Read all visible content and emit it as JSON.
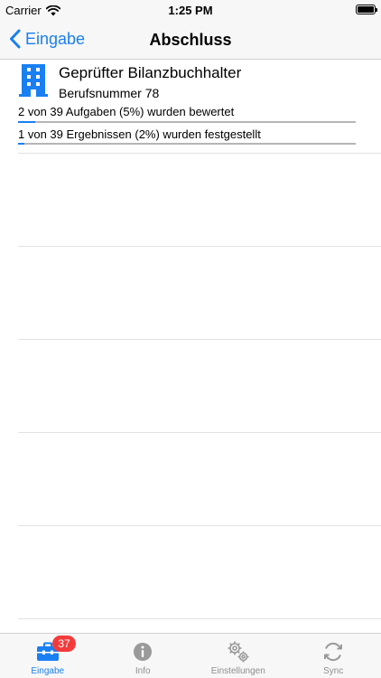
{
  "status_bar": {
    "carrier": "Carrier",
    "time": "1:25 PM"
  },
  "nav": {
    "back_label": "Eingabe",
    "title": "Abschluss"
  },
  "item": {
    "icon": "building-icon",
    "title": "Geprüfter Bilanzbuchhalter",
    "subtitle": "Berufsnummer 78",
    "progress": [
      {
        "label": "2 von 39 Aufgaben (5%) wurden bewertet",
        "percent": 5
      },
      {
        "label": "1 von 39 Ergebnissen (2%) wurden festgestellt",
        "percent": 2
      }
    ]
  },
  "tabs": [
    {
      "label": "Eingabe",
      "icon": "toolbox-icon",
      "active": true,
      "badge": "37"
    },
    {
      "label": "Info",
      "icon": "info-icon",
      "active": false
    },
    {
      "label": "Einstellungen",
      "icon": "gears-icon",
      "active": false
    },
    {
      "label": "Sync",
      "icon": "sync-icon",
      "active": false
    }
  ],
  "colors": {
    "accent": "#1a7ff2",
    "badge": "#f43b3b",
    "inactive": "#8e8e8e",
    "track": "#b5b5b5"
  }
}
